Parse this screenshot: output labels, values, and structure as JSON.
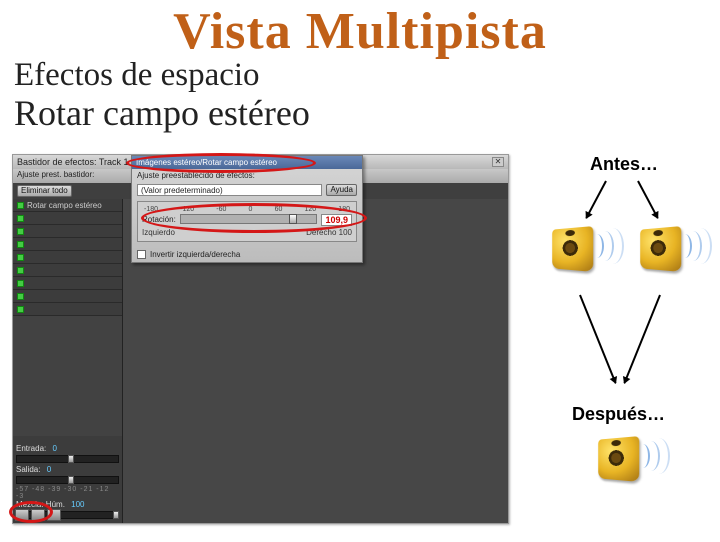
{
  "title": "Vista Multipista",
  "subtitle1": "Efectos de espacio",
  "subtitle2": "Rotar campo estéreo",
  "window": {
    "title": "Bastidor de efectos: Track 1",
    "close": "✕",
    "presets_label": "Ajuste prest. bastidor:",
    "remove_btn": "Eliminar todo"
  },
  "rack": {
    "slot_effect": "Rotar campo estéreo",
    "input_label": "Entrada:",
    "input_val": "0",
    "output_label": "Salida:",
    "output_val": "0",
    "mix_label": "Mezcla:",
    "mix_wet": "Húm.",
    "mix_val": "100"
  },
  "dialog": {
    "title": "Imágenes estéreo/Rotar campo estéreo",
    "preset_label": "Ajuste preestablecido de efectos:",
    "preset_value": "(Valor predeterminado)",
    "help": "Ayuda",
    "rotation_label": "Rotación:",
    "ticks": [
      "-180",
      "-120",
      "-60",
      "0",
      "60",
      "120",
      "180"
    ],
    "rotation_value": "109,9",
    "left": "Izquierdo",
    "right": "Derecho",
    "right_val": "100",
    "invert_label": "Invertir izquierda/derecha"
  },
  "right": {
    "antes": "Antes…",
    "despues": "Después…"
  }
}
